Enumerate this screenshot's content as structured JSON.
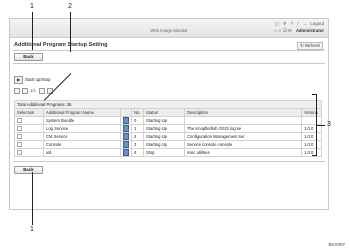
{
  "header": {
    "title": "Web Image Monitor",
    "icons": [
      "home-icon",
      "help-icon",
      "search-icon",
      "info-icon"
    ],
    "logout": "Logout",
    "row2_left": "⌂ ☆ ☑ ✉",
    "user": "Administrator"
  },
  "page": {
    "title": "Additional Program Startup Setting",
    "refresh": "Refresh",
    "back_top": "Back",
    "back_bottom": "Back",
    "start_label": "Start up/Stop",
    "pager": "1/1"
  },
  "table": {
    "caption": "Total Additional Programs: 36",
    "headers": [
      "Selection",
      "Additional Program Name",
      "",
      "No.",
      "Status",
      "Description",
      "Version"
    ],
    "rows": [
      {
        "name": "System Bundle",
        "no": "0",
        "status": "Starting Up",
        "desc": "",
        "ver": ""
      },
      {
        "name": "Log Service",
        "no": "1",
        "status": "Starting Up",
        "desc": "The Knopflerfish OSGi log se",
        "ver": "1.0.0"
      },
      {
        "name": "CM Service",
        "no": "2",
        "status": "Starting Up",
        "desc": "Configuration Management ser",
        "ver": "1.0.0"
      },
      {
        "name": "Console",
        "no": "3",
        "status": "Starting Up",
        "desc": "Service console console",
        "ver": "1.0.0"
      },
      {
        "name": "util",
        "no": "4",
        "status": "Stop",
        "desc": "misc utilities",
        "ver": "1.0.0"
      }
    ]
  },
  "callouts": {
    "c1": "1",
    "c2": "2",
    "c3": "3",
    "c4": "1"
  },
  "figure_id": "BKX007"
}
